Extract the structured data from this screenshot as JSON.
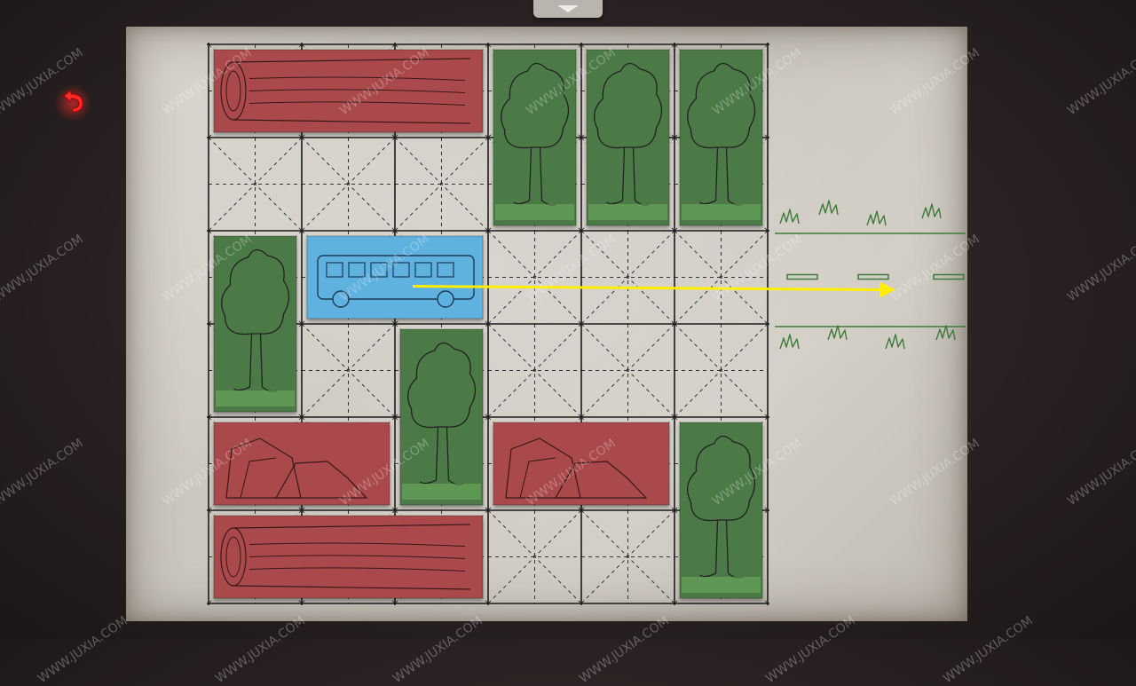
{
  "game": {
    "back_button": "back-arrow-icon",
    "top_tab": "menu-dropdown-tab",
    "grid": {
      "cols": 6,
      "rows": 6
    },
    "exit": {
      "row": 2,
      "label": "road-exit"
    },
    "pieces": [
      {
        "id": "log-top",
        "type": "log",
        "color": "#a94a4b",
        "col": 0,
        "row": 0,
        "w": 3,
        "h": 1,
        "player": false
      },
      {
        "id": "tree-c3",
        "type": "tree",
        "color": "#4c7a47",
        "col": 3,
        "row": 0,
        "w": 1,
        "h": 2,
        "player": false
      },
      {
        "id": "tree-c4",
        "type": "tree",
        "color": "#4c7a47",
        "col": 4,
        "row": 0,
        "w": 1,
        "h": 2,
        "player": false
      },
      {
        "id": "tree-c5",
        "type": "tree",
        "color": "#4c7a47",
        "col": 5,
        "row": 0,
        "w": 1,
        "h": 2,
        "player": false
      },
      {
        "id": "tree-left",
        "type": "tree",
        "color": "#4c7a47",
        "col": 0,
        "row": 2,
        "w": 1,
        "h": 2,
        "player": false
      },
      {
        "id": "bus",
        "type": "bus",
        "color": "#5fb1e0",
        "col": 1,
        "row": 2,
        "w": 2,
        "h": 1,
        "player": true
      },
      {
        "id": "tree-mid",
        "type": "tree",
        "color": "#4c7a47",
        "col": 2,
        "row": 3,
        "w": 1,
        "h": 2,
        "player": false
      },
      {
        "id": "rock-left",
        "type": "rock",
        "color": "#a94a4b",
        "col": 0,
        "row": 4,
        "w": 2,
        "h": 1,
        "player": false
      },
      {
        "id": "rock-right",
        "type": "rock",
        "color": "#a94a4b",
        "col": 3,
        "row": 4,
        "w": 2,
        "h": 1,
        "player": false
      },
      {
        "id": "tree-bottom",
        "type": "tree",
        "color": "#4c7a47",
        "col": 5,
        "row": 4,
        "w": 1,
        "h": 2,
        "player": false
      },
      {
        "id": "log-bottom",
        "type": "log",
        "color": "#a94a4b",
        "col": 0,
        "row": 5,
        "w": 3,
        "h": 1,
        "player": false
      }
    ],
    "hint_arrow": {
      "from_col": 2,
      "row": 2,
      "color": "#ffee00",
      "label": "move-hint-arrow"
    }
  },
  "watermark": "WWW.JUXIA.COM"
}
